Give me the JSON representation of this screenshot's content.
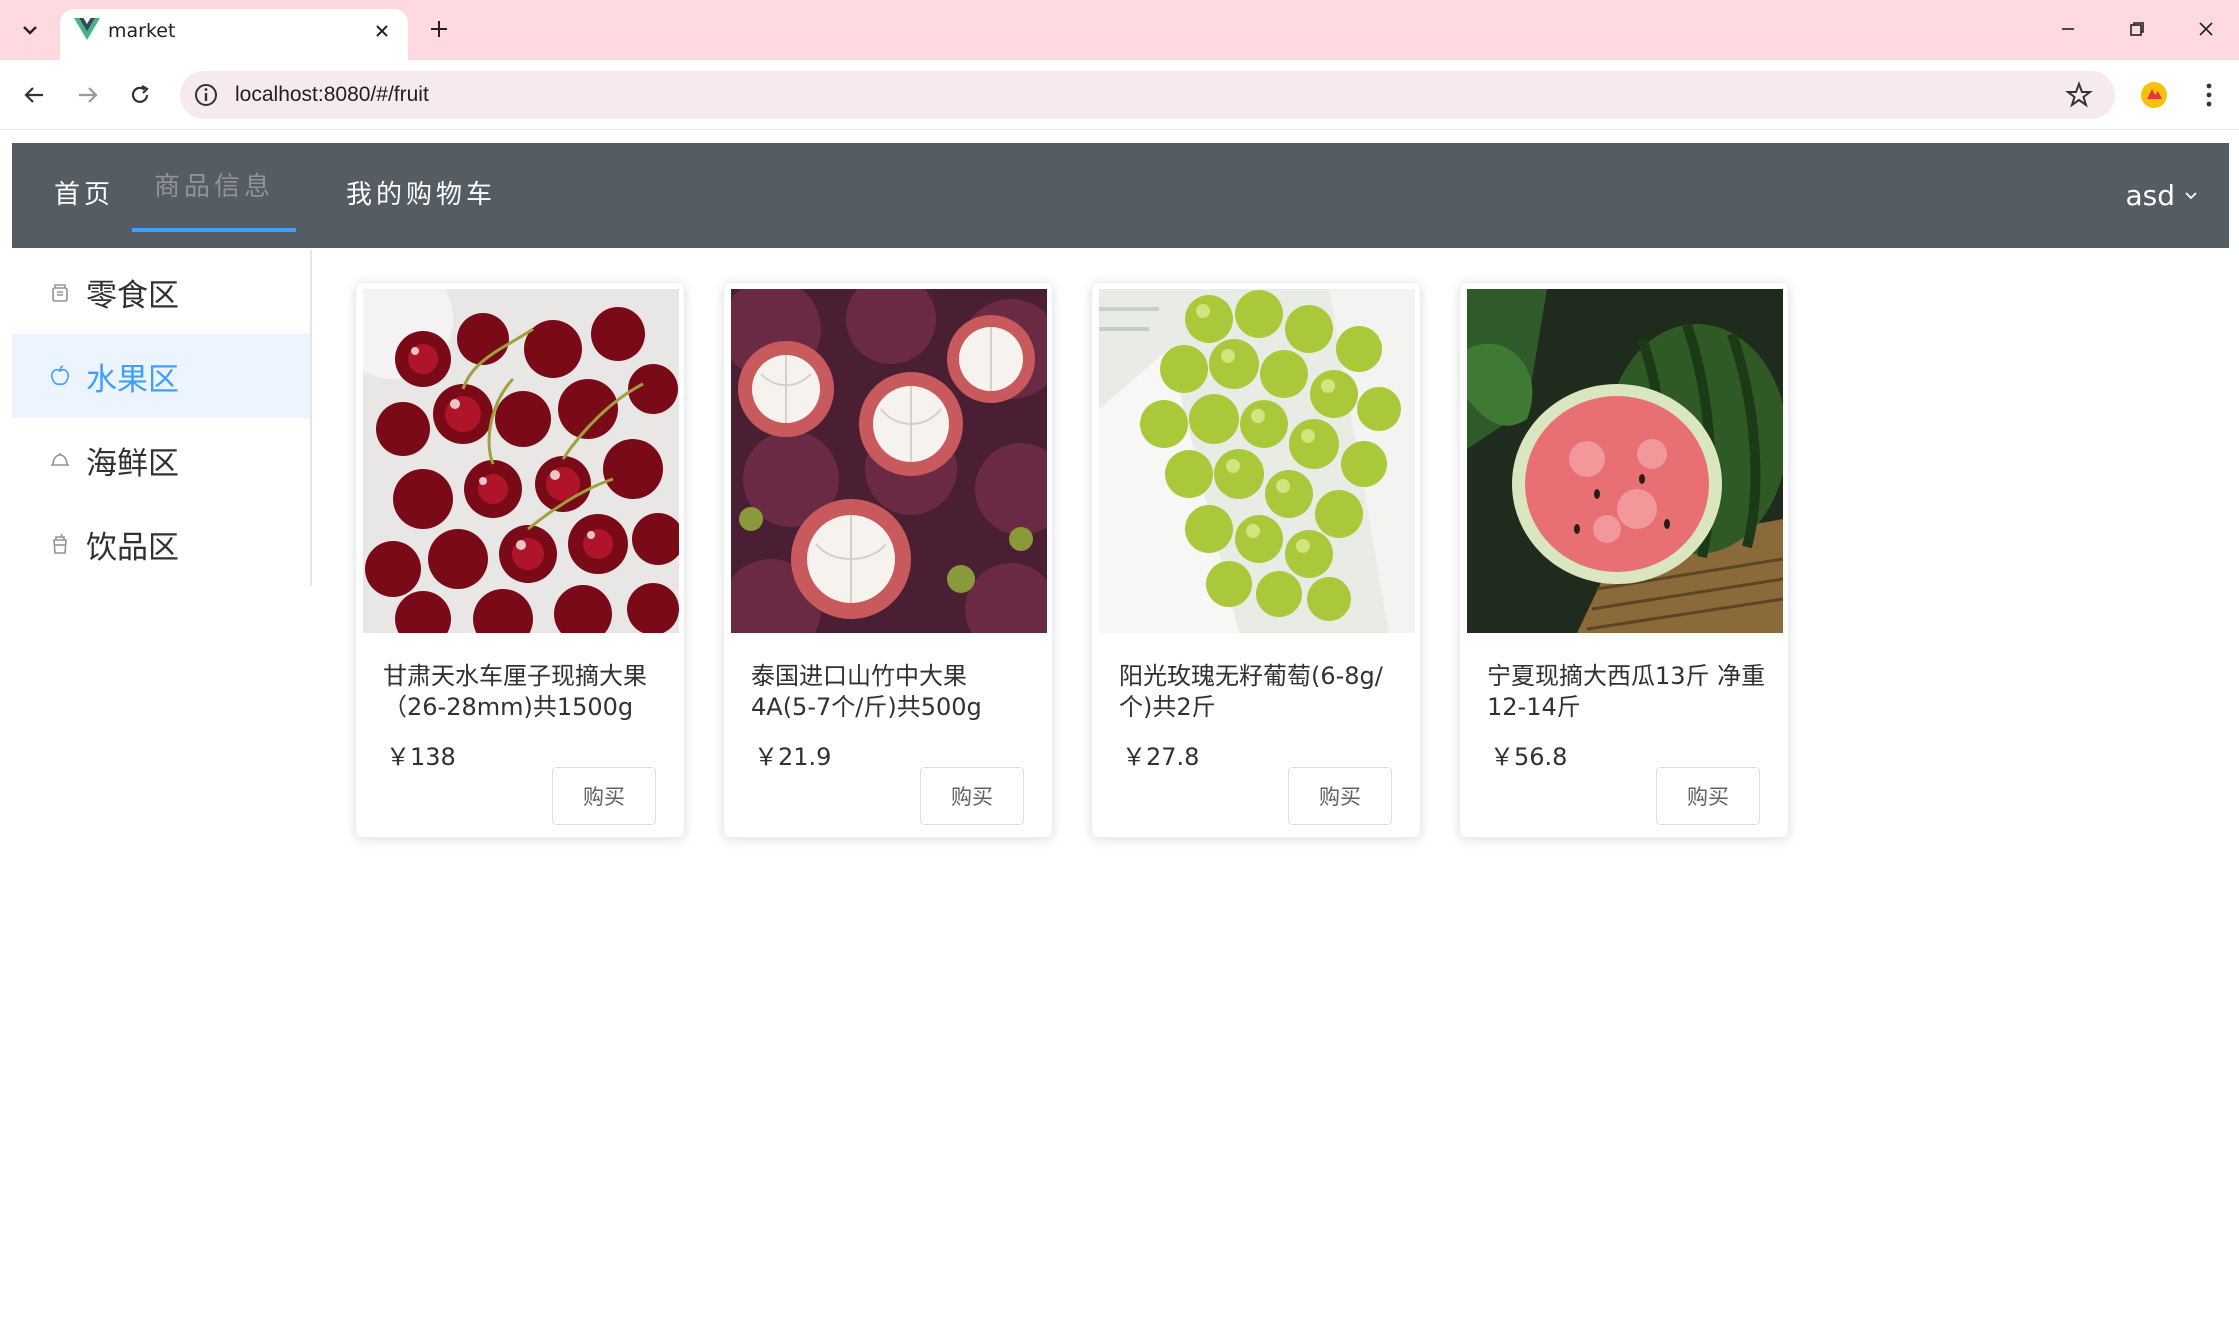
{
  "browser": {
    "tab_title": "market",
    "url": "localhost:8080/#/fruit",
    "icons": {
      "tab_menu": "chevron-down-icon",
      "favicon": "vue-logo-icon",
      "close": "close-icon",
      "new_tab": "plus-icon",
      "back": "arrow-left-icon",
      "forward": "arrow-right-icon",
      "reload": "reload-icon",
      "site_info": "info-icon",
      "bookmark": "star-icon",
      "extension": "extension-icon",
      "menu": "kebab-menu-icon"
    }
  },
  "header": {
    "menu": [
      {
        "label": "首页",
        "active": false
      },
      {
        "label": "商品信息",
        "active": true
      },
      {
        "label": "我的购物车",
        "active": false
      }
    ],
    "user": "asd"
  },
  "sidebar": {
    "items": [
      {
        "label": "零食区",
        "icon": "snack-icon",
        "active": false
      },
      {
        "label": "水果区",
        "icon": "apple-icon",
        "active": true
      },
      {
        "label": "海鲜区",
        "icon": "dish-cover-icon",
        "active": false
      },
      {
        "label": "饮品区",
        "icon": "cup-icon",
        "active": false
      }
    ]
  },
  "products": [
    {
      "name": "甘肃天水车厘子现摘大果（26-28mm)共1500g",
      "price": "￥138",
      "buy": "购买",
      "image": "cherries"
    },
    {
      "name": "泰国进口山竹中大果4A(5-7个/斤)共500g",
      "price": "￥21.9",
      "buy": "购买",
      "image": "mangosteen"
    },
    {
      "name": "阳光玫瑰无籽葡萄(6-8g/个)共2斤",
      "price": "￥27.8",
      "buy": "购买",
      "image": "green-grapes"
    },
    {
      "name": "宁夏现摘大西瓜13斤 净重12-14斤",
      "price": "￥56.8",
      "buy": "购买",
      "image": "watermelon"
    }
  ],
  "colors": {
    "header_bg": "#545c64",
    "accent": "#409eff",
    "active_side_bg": "#ecf5ff",
    "tabstrip_bg": "#ffd9e0"
  }
}
